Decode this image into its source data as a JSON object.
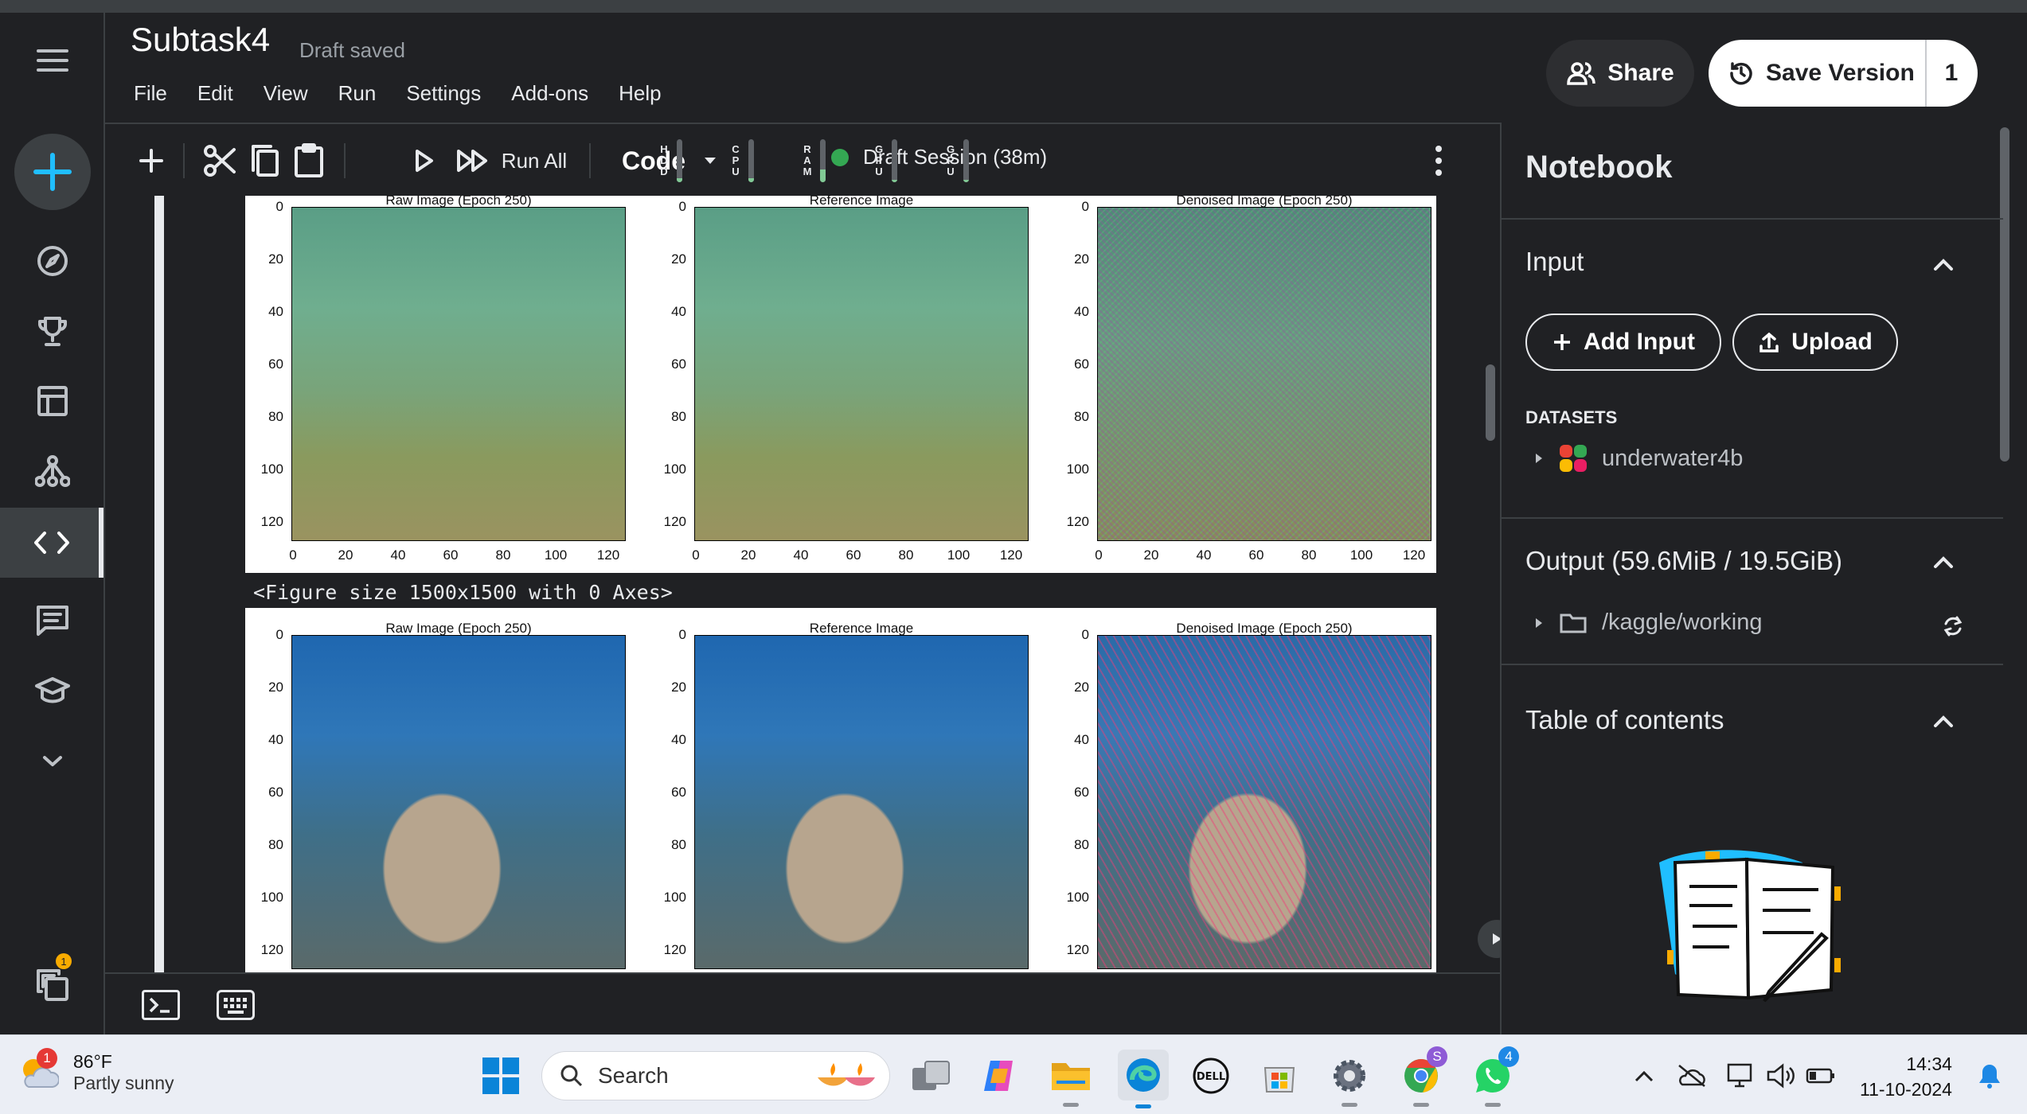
{
  "header": {
    "title": "Subtask4",
    "status": "Draft saved",
    "menu": [
      "File",
      "Edit",
      "View",
      "Run",
      "Settings",
      "Add-ons",
      "Help"
    ],
    "share_label": "Share",
    "save_version_label": "Save Version",
    "save_version_count": "1"
  },
  "toolbar": {
    "run_all_label": "Run All",
    "cell_type": "Code",
    "session_label": "Draft Session (38m)",
    "meters": [
      {
        "label": "HDD",
        "level": 0.1
      },
      {
        "label": "CPU",
        "level": 0.1
      },
      {
        "label": "RAM",
        "level": 0.3
      },
      {
        "label": "GPU",
        "level": 0.05
      },
      {
        "label": "GPU",
        "level": 0.05
      }
    ]
  },
  "output": {
    "figure_text": "<Figure size 1500x1500 with 0 Axes>",
    "figures": [
      {
        "panels": [
          {
            "title": "Raw Image (Epoch 250)",
            "palette": "greenwater"
          },
          {
            "title": "Reference Image",
            "palette": "greenwater"
          },
          {
            "title": "Denoised Image (Epoch 250)",
            "palette": "noisygreen"
          }
        ]
      },
      {
        "panels": [
          {
            "title": "Raw Image (Epoch 250)",
            "palette": "bluereef"
          },
          {
            "title": "Reference Image",
            "palette": "bluereef"
          },
          {
            "title": "Denoised Image (Epoch 250)",
            "palette": "noisyblue"
          }
        ]
      }
    ],
    "y_ticks": [
      "0",
      "20",
      "40",
      "60",
      "80",
      "100",
      "120"
    ],
    "x_ticks": [
      "0",
      "20",
      "40",
      "60",
      "80",
      "100",
      "120"
    ]
  },
  "right_panel": {
    "heading": "Notebook",
    "input_section": "Input",
    "add_input_label": "Add Input",
    "upload_label": "Upload",
    "datasets_label": "DATASETS",
    "dataset_name": "underwater4b",
    "output_section": "Output (59.6MiB / 19.5GiB)",
    "output_path": "/kaggle/working",
    "toc_section": "Table of contents"
  },
  "taskbar": {
    "weather_temp": "86°F",
    "weather_desc": "Partly sunny",
    "weather_badge": "1",
    "search_placeholder": "Search",
    "chrome_badge": "S",
    "whatsapp_badge": "4",
    "time": "14:34",
    "date": "11-10-2024"
  },
  "colors": {
    "accent_green": "#34a853",
    "background": "#202124",
    "panel_border": "#3c4043"
  }
}
